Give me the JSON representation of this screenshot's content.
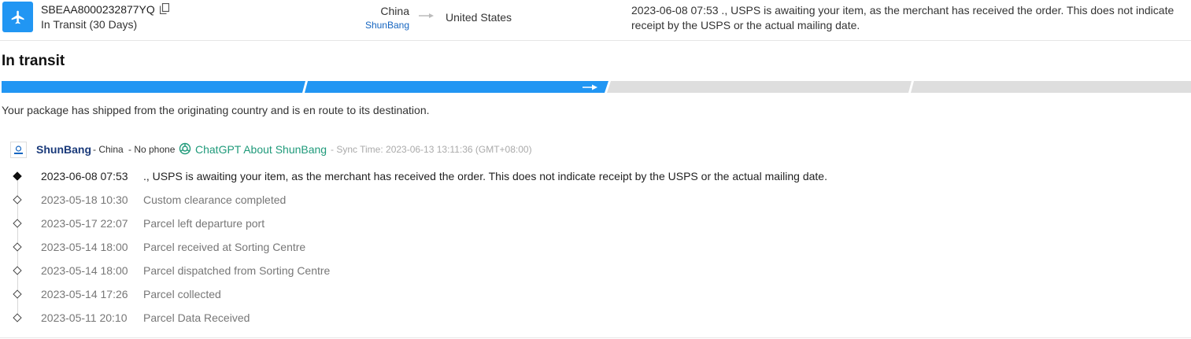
{
  "header": {
    "tracking_number": "SBEAA8000232877YQ",
    "transit_days": "In Transit (30 Days)",
    "origin_country": "China",
    "origin_carrier": "ShunBang",
    "destination_country": "United States",
    "latest_event": "2023-06-08 07:53 ., USPS is awaiting your item, as the merchant has received the order. This does not indicate receipt by the USPS or the actual mailing date."
  },
  "status": {
    "title": "In transit",
    "description": "Your package has shipped from the originating country and is en route to its destination.",
    "progress_stage": 2,
    "progress_total": 4
  },
  "carrier": {
    "name": "ShunBang",
    "country": "- China",
    "phone": "- No phone",
    "gpt_link": "ChatGPT About ShunBang",
    "sync_time": "- Sync Time: 2023-06-13 13:11:36 (GMT+08:00)"
  },
  "events": [
    {
      "time": "2023-06-08 07:53",
      "desc": "., USPS is awaiting your item, as the merchant has received the order. This does not indicate receipt by the USPS or the actual mailing date."
    },
    {
      "time": "2023-05-18 10:30",
      "desc": "Custom clearance completed"
    },
    {
      "time": "2023-05-17 22:07",
      "desc": "Parcel left departure port"
    },
    {
      "time": "2023-05-14 18:00",
      "desc": "Parcel received at Sorting Centre"
    },
    {
      "time": "2023-05-14 18:00",
      "desc": "Parcel dispatched from Sorting Centre"
    },
    {
      "time": "2023-05-14 17:26",
      "desc": "Parcel collected"
    },
    {
      "time": "2023-05-11 20:10",
      "desc": "Parcel Data Received"
    }
  ],
  "colors": {
    "accent": "#2196f3",
    "progress_inactive": "#dedede",
    "gpt_green": "#1f9a7a"
  },
  "icons": {
    "carrier": "airplane-icon",
    "copy": "copy-icon",
    "route": "arrow-right-icon",
    "gpt": "openai-icon"
  }
}
